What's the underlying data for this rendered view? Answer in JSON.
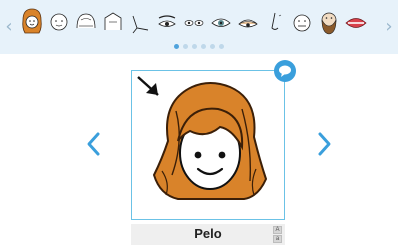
{
  "strip": {
    "prev_icon": "chevron-left-icon",
    "next_icon": "chevron-right-icon",
    "thumbnails": [
      "hair-icon",
      "head-icon",
      "scalp-icon",
      "forehead-icon",
      "eyebrow-icon",
      "eye-icon",
      "eyes-icon",
      "eyelid-icon",
      "eyelash-icon",
      "nose-icon",
      "face-icon",
      "beard-icon",
      "mouth-icon"
    ],
    "page_count": 6,
    "current_page": 1
  },
  "card": {
    "label": "Pelo",
    "speech_icon": "speech-bubble-icon",
    "pointer_icon": "arrow-icon"
  },
  "nav": {
    "prev_icon": "chevron-left-icon",
    "next_icon": "chevron-right-icon"
  },
  "colors": {
    "accent": "#3a9fdc",
    "strip_bg": "#e7f2fa",
    "hair": "#d9832a",
    "card_border": "#6bc2e6"
  }
}
